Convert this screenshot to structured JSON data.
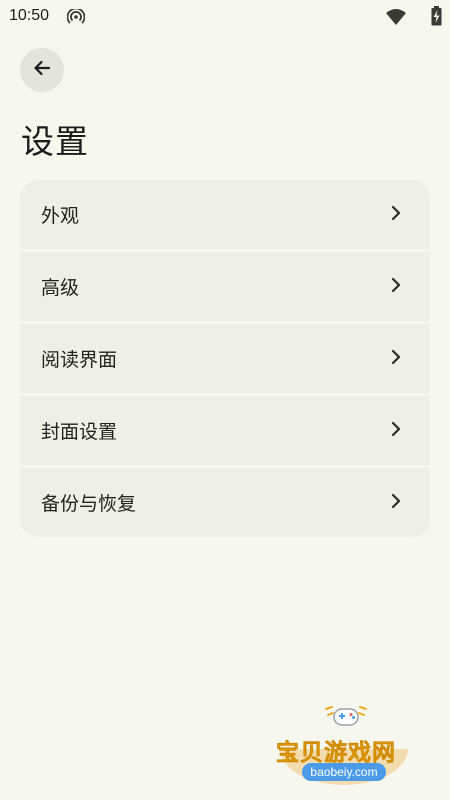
{
  "status_bar": {
    "time": "10:50",
    "icons": [
      "cast-icon",
      "wifi-icon",
      "battery-charging-icon"
    ]
  },
  "header": {
    "back_icon": "arrow-left-icon",
    "title": "设置"
  },
  "settings": {
    "items": [
      {
        "label": "外观",
        "icon": "chevron-right-icon"
      },
      {
        "label": "高级",
        "icon": "chevron-right-icon"
      },
      {
        "label": "阅读界面",
        "icon": "chevron-right-icon"
      },
      {
        "label": "封面设置",
        "icon": "chevron-right-icon"
      },
      {
        "label": "备份与恢复",
        "icon": "chevron-right-icon"
      }
    ]
  },
  "watermark": {
    "text": "宝贝游戏网",
    "domain": "baobeiy.com"
  },
  "colors": {
    "background": "#f6f7ef",
    "card": "#eeefe6",
    "back_button": "#e3e4dc",
    "watermark_orange": "#f2a81c",
    "watermark_blue": "#4c9be8"
  }
}
